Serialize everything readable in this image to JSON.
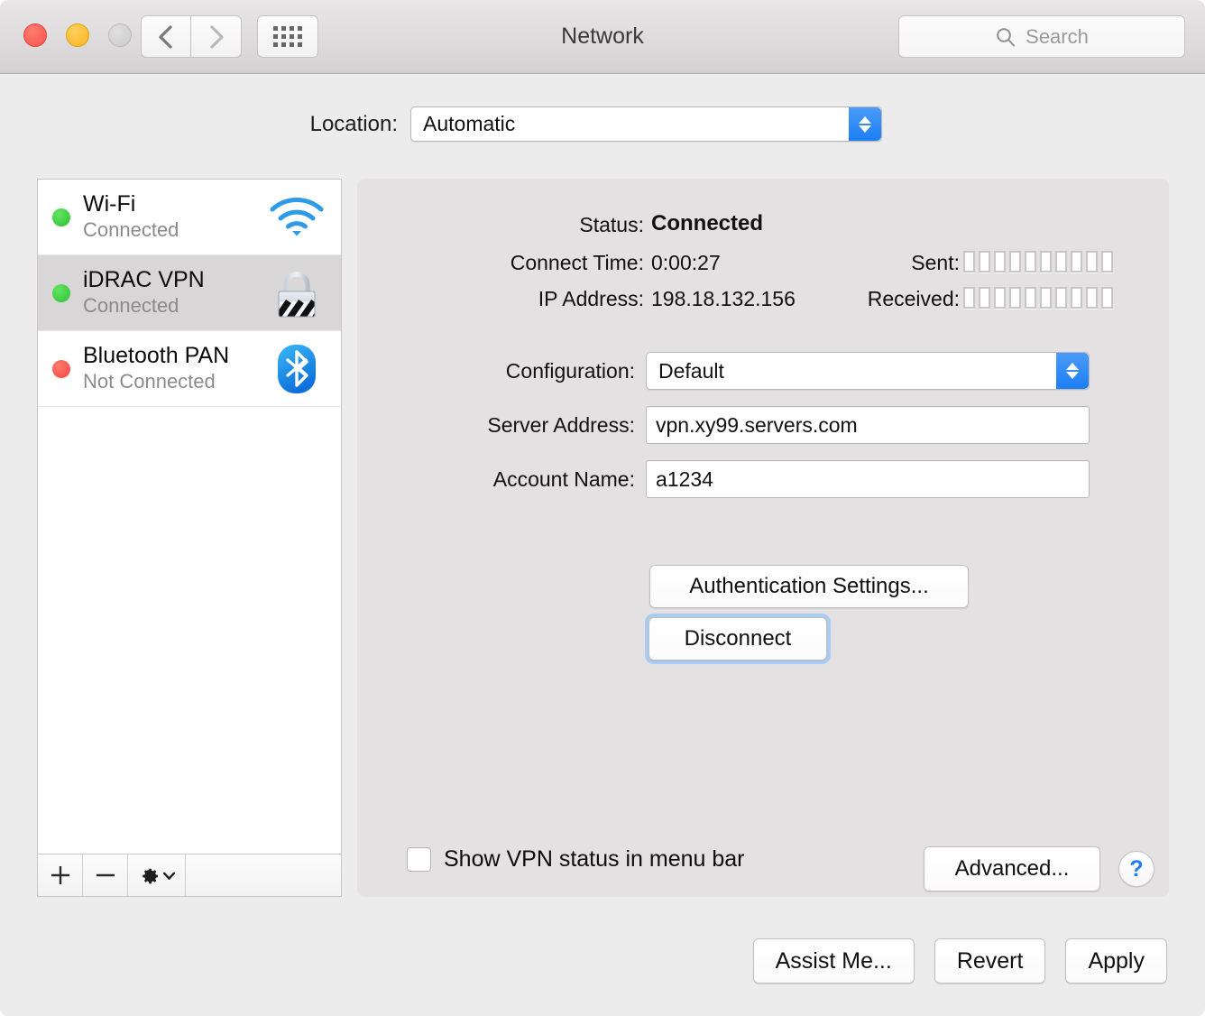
{
  "window": {
    "title": "Network",
    "traffic_lights": [
      "close",
      "minimize",
      "zoom"
    ]
  },
  "toolbar": {
    "back_icon": "chevron-left-icon",
    "forward_icon": "chevron-right-icon",
    "show_all_icon": "grid-dots-icon",
    "search": {
      "placeholder": "Search",
      "value": "",
      "icon": "search-icon"
    }
  },
  "location": {
    "label": "Location:",
    "selected": "Automatic",
    "options": [
      "Automatic"
    ]
  },
  "services": [
    {
      "name": "Wi-Fi",
      "status": "Connected",
      "dot": "green",
      "icon": "wifi-icon",
      "selected": false
    },
    {
      "name": "iDRAC VPN",
      "status": "Connected",
      "dot": "green",
      "icon": "lock-vpn-icon",
      "selected": true
    },
    {
      "name": "Bluetooth PAN",
      "status": "Not Connected",
      "dot": "red",
      "icon": "bluetooth-icon",
      "selected": false
    }
  ],
  "sidebar_toolbar": {
    "add_label": "+",
    "remove_label": "—",
    "action_icon": "gear-icon",
    "action_chevron": "chevron-down-icon"
  },
  "details": {
    "status_label": "Status:",
    "status_value": "Connected",
    "connect_time_label": "Connect Time:",
    "connect_time_value": "0:00:27",
    "ip_label": "IP Address:",
    "ip_value": "198.18.132.156",
    "sent_label": "Sent:",
    "received_label": "Received:",
    "sent_segments": 10,
    "sent_filled": 0,
    "received_segments": 10,
    "received_filled": 0
  },
  "form": {
    "configuration_label": "Configuration:",
    "configuration_value": "Default",
    "configuration_options": [
      "Default"
    ],
    "server_label": "Server Address:",
    "server_value": "vpn.xy99.servers.com",
    "account_label": "Account Name:",
    "account_value": "a1234"
  },
  "actions": {
    "auth_settings": "Authentication Settings...",
    "disconnect": "Disconnect",
    "disconnect_focused": true
  },
  "footer": {
    "checkbox_label": "Show VPN status in menu bar",
    "checkbox_checked": false,
    "advanced": "Advanced...",
    "help": "?"
  },
  "bottom_buttons": {
    "assist": "Assist Me...",
    "revert": "Revert",
    "apply": "Apply"
  },
  "colors": {
    "accent_blue": "#1b7ef3",
    "status_green": "#2bc22f",
    "status_red": "#f2483c",
    "focus_ring": "#a8cdf0"
  }
}
